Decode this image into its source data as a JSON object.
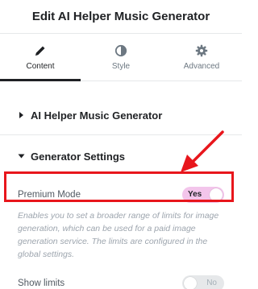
{
  "header": {
    "title": "Edit AI Helper Music Generator"
  },
  "tabs": [
    {
      "label": "Content",
      "icon": "pencil-icon",
      "active": true
    },
    {
      "label": "Style",
      "icon": "half-circle-icon",
      "active": false
    },
    {
      "label": "Advanced",
      "icon": "gear-icon",
      "active": false
    }
  ],
  "sections": {
    "ai_helper": {
      "title": "AI Helper Music Generator",
      "expanded": false
    },
    "generator_settings": {
      "title": "Generator Settings",
      "expanded": true
    }
  },
  "controls": {
    "premium_mode": {
      "label": "Premium Mode",
      "toggle_text": "Yes",
      "enabled": true
    },
    "premium_description": "Enables you to set a broader range of limits for image generation, which can be used for a paid image generation service. The limits are configured in the global settings.",
    "show_limits": {
      "label": "Show limits",
      "toggle_text": "No",
      "enabled": false
    }
  },
  "colors": {
    "highlight": "#e8161c",
    "toggle_on": "#f3c5eb",
    "toggle_off": "#e6e8ea"
  }
}
